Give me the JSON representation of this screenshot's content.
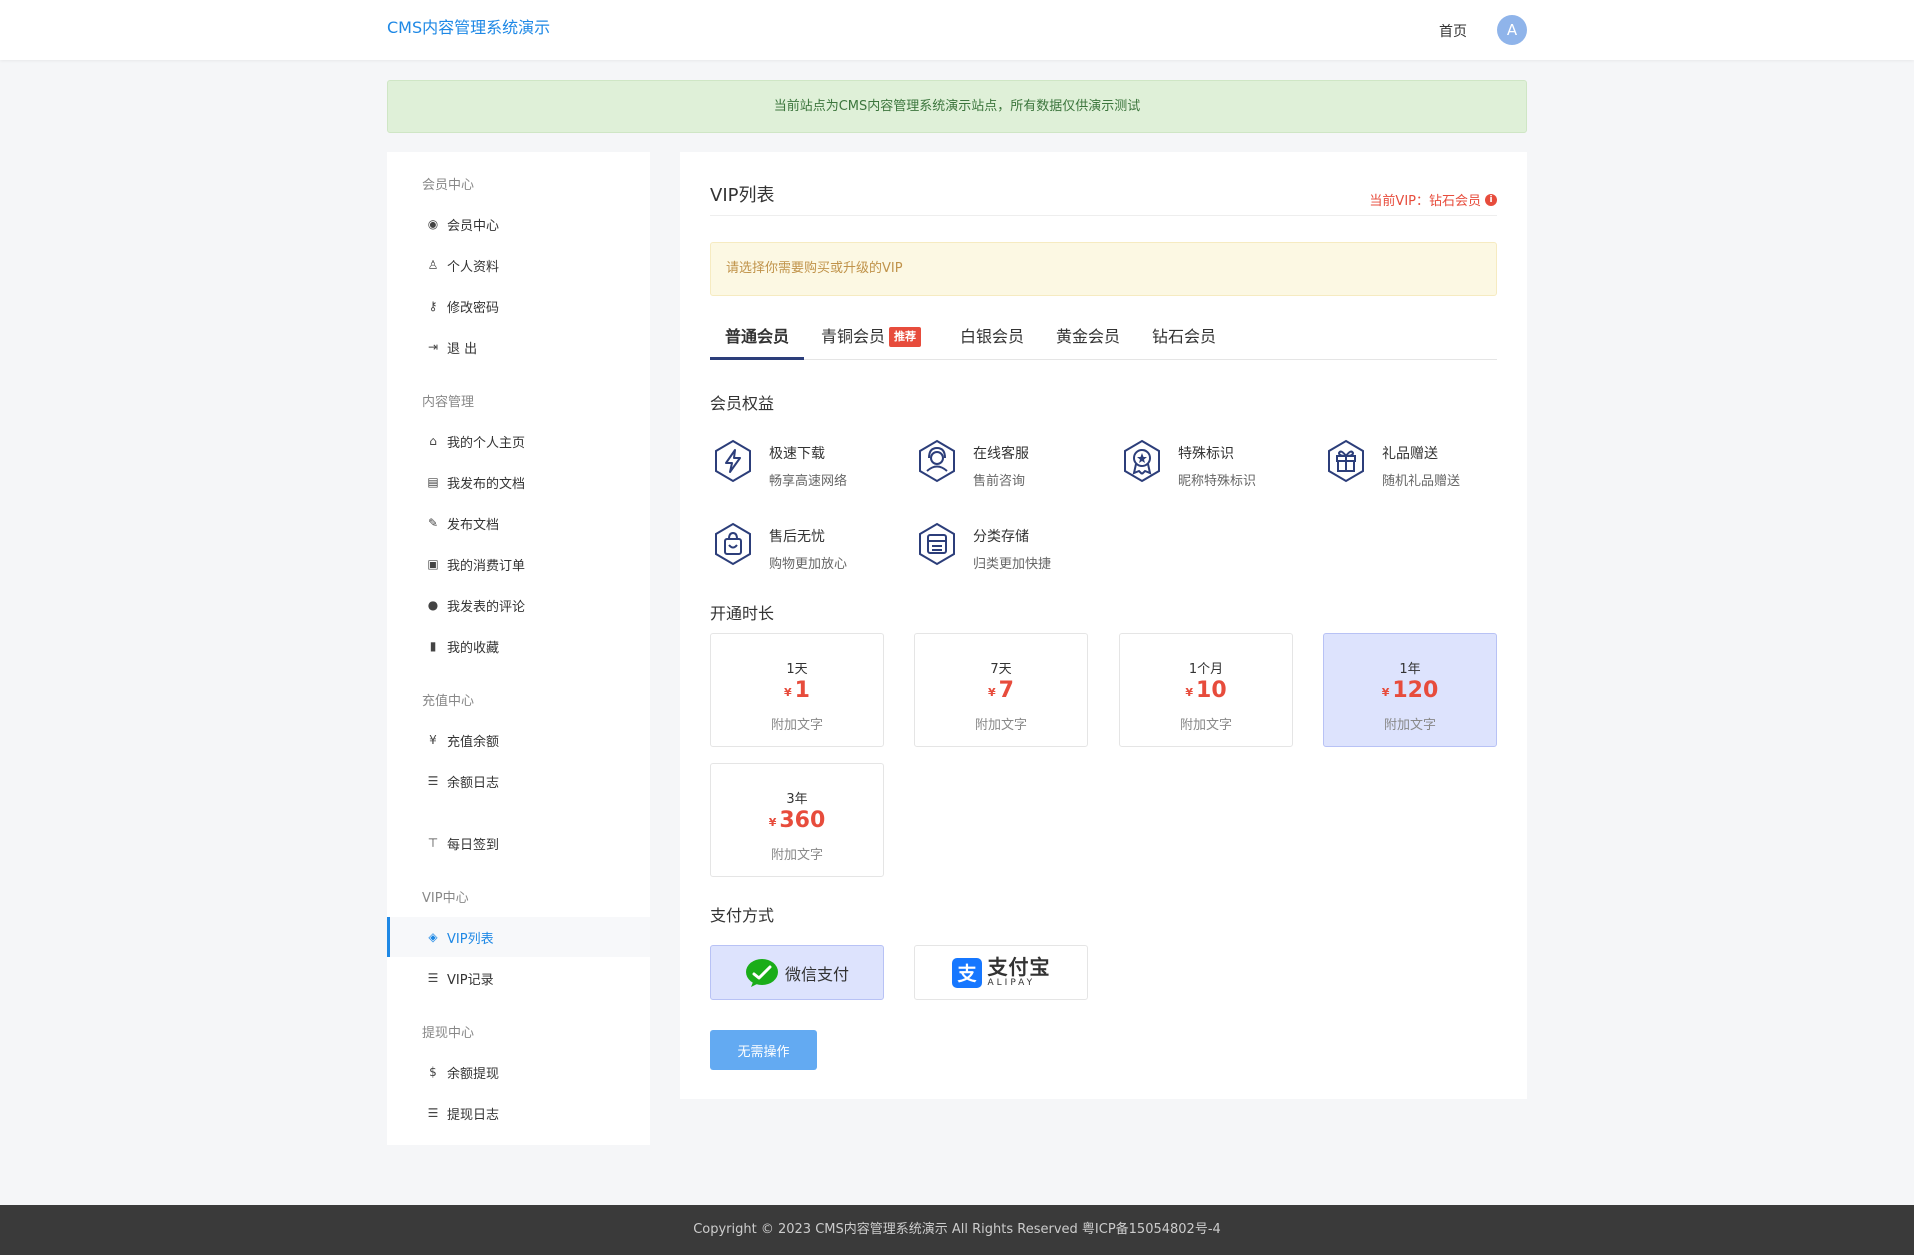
{
  "header": {
    "brand": "CMS内容管理系统演示",
    "home_label": "首页",
    "avatar_letter": "A"
  },
  "notice": "当前站点为CMS内容管理系统演示站点，所有数据仅供演示测试",
  "sidebar": {
    "groups": [
      {
        "title": "会员中心",
        "items": [
          {
            "icon": "user-circle-icon",
            "label": "会员中心"
          },
          {
            "icon": "user-icon",
            "label": "个人资料"
          },
          {
            "icon": "key-icon",
            "label": "修改密码"
          },
          {
            "icon": "sign-out-icon",
            "label": "退 出"
          }
        ]
      },
      {
        "title": "内容管理",
        "items": [
          {
            "icon": "home-icon",
            "label": "我的个人主页"
          },
          {
            "icon": "newspaper-icon",
            "label": "我发布的文档"
          },
          {
            "icon": "pencil-icon",
            "label": "发布文档"
          },
          {
            "icon": "shopping-bag-icon",
            "label": "我的消费订单"
          },
          {
            "icon": "comments-icon",
            "label": "我发表的评论"
          },
          {
            "icon": "bookmark-icon",
            "label": "我的收藏"
          }
        ]
      },
      {
        "title": "充值中心",
        "items": [
          {
            "icon": "yen-icon",
            "label": "充值余额"
          },
          {
            "icon": "list-icon",
            "label": "余额日志"
          },
          {
            "icon": "signpost-icon",
            "label": "每日签到"
          }
        ]
      },
      {
        "title": "VIP中心",
        "items": [
          {
            "icon": "diamond-icon",
            "label": "VIP列表"
          },
          {
            "icon": "list-icon",
            "label": "VIP记录"
          }
        ]
      },
      {
        "title": "提现中心",
        "items": [
          {
            "icon": "dollar-icon",
            "label": "余额提现"
          },
          {
            "icon": "list-icon",
            "label": "提现日志"
          }
        ]
      }
    ]
  },
  "main": {
    "title": "VIP列表",
    "current_vip": "当前VIP：钻石会员",
    "tip": "请选择你需要购买或升级的VIP",
    "tabs": [
      {
        "label": "普通会员"
      },
      {
        "label": "青铜会员",
        "badge": "推荐"
      },
      {
        "label": "白银会员"
      },
      {
        "label": "黄金会员"
      },
      {
        "label": "钻石会员"
      }
    ],
    "benefits_title": "会员权益",
    "benefits": [
      {
        "icon": "lightning-icon",
        "title": "极速下载",
        "desc": "畅享高速网络"
      },
      {
        "icon": "customer-service-icon",
        "title": "在线客服",
        "desc": "售前咨询"
      },
      {
        "icon": "award-icon",
        "title": "特殊标识",
        "desc": "昵称特殊标识"
      },
      {
        "icon": "gift-icon",
        "title": "礼品赠送",
        "desc": "随机礼品赠送"
      },
      {
        "icon": "shopping-bag-icon",
        "title": "售后无忧",
        "desc": "购物更加放心"
      },
      {
        "icon": "storage-icon",
        "title": "分类存储",
        "desc": "归类更加快捷"
      }
    ],
    "duration_title": "开通时长",
    "plans": [
      {
        "name": "1天",
        "currency": "¥",
        "price": "1",
        "note": "附加文字"
      },
      {
        "name": "7天",
        "currency": "¥",
        "price": "7",
        "note": "附加文字"
      },
      {
        "name": "1个月",
        "currency": "¥",
        "price": "10",
        "note": "附加文字"
      },
      {
        "name": "1年",
        "currency": "¥",
        "price": "120",
        "note": "附加文字"
      },
      {
        "name": "3年",
        "currency": "¥",
        "price": "360",
        "note": "附加文字"
      }
    ],
    "payment_title": "支付方式",
    "payments": {
      "wechat_label": "微信支付",
      "alipay_main": "支付宝",
      "alipay_sub": "ALIPAY"
    },
    "submit_label": "无需操作"
  },
  "footer": "Copyright © 2023 CMS内容管理系统演示 All Rights Reserved 粤ICP备15054802号-4",
  "colors": {
    "accent": "#1e88e5",
    "price": "#e74c3c",
    "selected_bg": "#dde3fd",
    "icon_navy": "#2c3e7a"
  }
}
